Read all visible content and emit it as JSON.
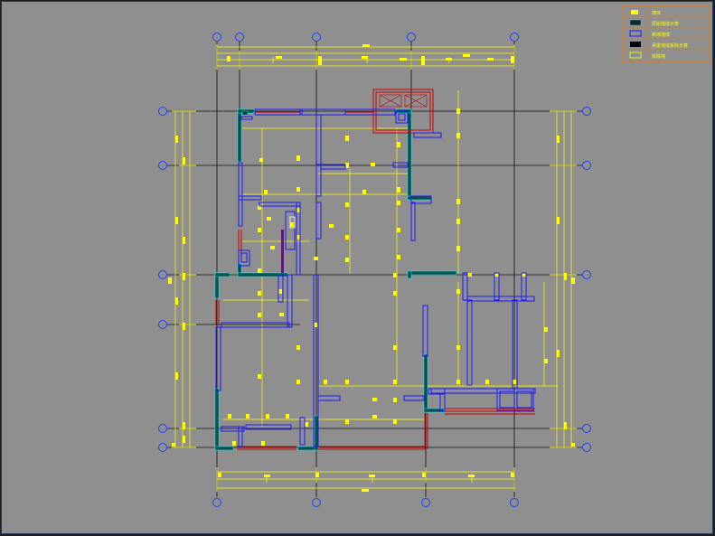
{
  "drawing": {
    "background": "#8f8f8f",
    "colors": {
      "yellow": "#ffff00",
      "dim_yellow": "#ffff66",
      "blue": "#1a1aff",
      "red": "#cc0000",
      "teal": "#0a4a4a",
      "axis": "#111111",
      "circle": "#2040ff",
      "purple": "#7a00aa",
      "orange": "#e07a1a"
    }
  },
  "legend": {
    "rows": [
      {
        "swatch": "yellow-fill",
        "label": "墙体"
      },
      {
        "swatch": "dark-fill",
        "label": "原始墙体示意"
      },
      {
        "swatch": "blue-outline",
        "label": "新砌墙体"
      },
      {
        "swatch": "black-fill",
        "label": "承重墙体拆除示意"
      },
      {
        "swatch": "yellow-outline",
        "label": "拆除墙"
      }
    ]
  }
}
